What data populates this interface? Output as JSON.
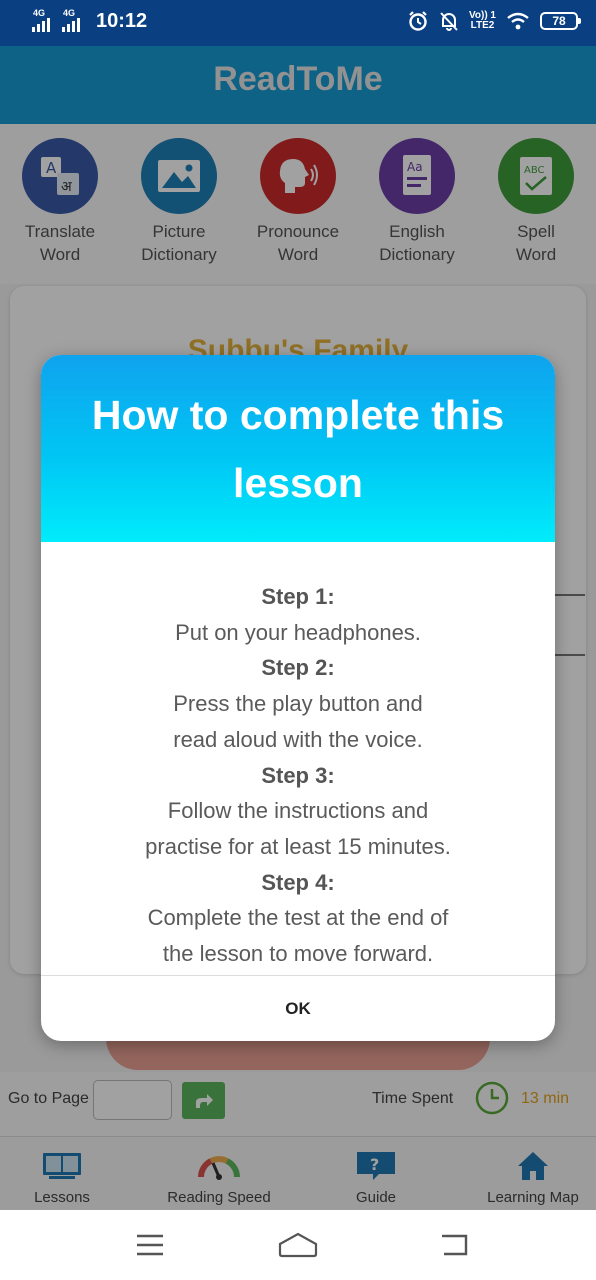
{
  "status_bar": {
    "network_1": "4G",
    "network_2": "4G",
    "time": "10:12",
    "volte_line1": "Vo)) 1",
    "volte_line2": "LTE2",
    "battery": "78"
  },
  "app": {
    "title": "ReadToMe"
  },
  "tools": [
    {
      "label_1": "Translate",
      "label_2": "Word",
      "icon": "translate-icon",
      "color": "#3a5aa8"
    },
    {
      "label_1": "Picture",
      "label_2": "Dictionary",
      "icon": "picture-icon",
      "color": "#1d7fb8"
    },
    {
      "label_1": "Pronounce",
      "label_2": "Word",
      "icon": "speaker-head-icon",
      "color": "#cc2b2b"
    },
    {
      "label_1": "English",
      "label_2": "Dictionary",
      "icon": "dictionary-icon",
      "color": "#6a3fa6"
    },
    {
      "label_1": "Spell",
      "label_2": "Word",
      "icon": "spell-icon",
      "color": "#3f9d3b"
    }
  ],
  "card": {
    "title": "Subbu's Family"
  },
  "page_nav": {
    "goto_label": "Go to Page",
    "page_value": "",
    "time_label": "Time Spent",
    "time_value": "13 min"
  },
  "bottom_nav": [
    {
      "label": "Lessons",
      "icon": "book-icon"
    },
    {
      "label": "Reading Speed",
      "icon": "speedometer-icon"
    },
    {
      "label": "Guide",
      "icon": "question-icon"
    },
    {
      "label": "Learning Map",
      "icon": "home-icon"
    }
  ],
  "dialog": {
    "title": "How to complete this lesson",
    "steps": [
      {
        "head": "Step 1:",
        "line1": "Put on your headphones.",
        "line2": ""
      },
      {
        "head": "Step 2:",
        "line1": "Press the play button and",
        "line2": "read aloud with the voice."
      },
      {
        "head": "Step 3:",
        "line1": "Follow the instructions and",
        "line2": "practise for at least 15 minutes."
      },
      {
        "head": "Step 4:",
        "line1": "Complete the test at the end of",
        "line2": "the lesson to move forward."
      }
    ],
    "ok_label": "OK"
  },
  "colors": {
    "status_bar": "#0a3f82",
    "header": "#159bd4",
    "dialog_gradient_top": "#0fa3ee",
    "dialog_gradient_bottom": "#00ecfb",
    "time_accent": "#e6a21e"
  }
}
